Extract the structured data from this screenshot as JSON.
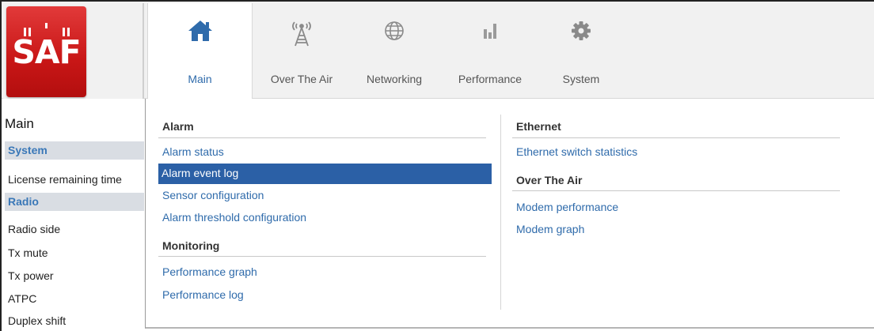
{
  "logo": {
    "text": "SAF"
  },
  "tabs": [
    {
      "label": "Main",
      "icon": "home-icon",
      "active": true
    },
    {
      "label": "Over The Air",
      "icon": "antenna-tower-icon",
      "active": false
    },
    {
      "label": "Networking",
      "icon": "globe-icon",
      "active": false
    },
    {
      "label": "Performance",
      "icon": "bar-chart-icon",
      "active": false
    },
    {
      "label": "System",
      "icon": "gear-icon",
      "active": false
    }
  ],
  "sidebar": {
    "title": "Main",
    "sections": [
      {
        "label": "System",
        "items": [
          "License remaining time"
        ]
      },
      {
        "label": "Radio",
        "items": [
          "Radio side",
          "Tx mute",
          "Tx power",
          "ATPC",
          "Duplex shift"
        ]
      }
    ]
  },
  "menu": {
    "left": {
      "groups": [
        {
          "heading": "Alarm",
          "links": [
            "Alarm status",
            "Alarm event log",
            "Sensor configuration",
            "Alarm threshold configuration"
          ]
        },
        {
          "heading": "Monitoring",
          "links": [
            "Performance graph",
            "Performance log"
          ]
        }
      ]
    },
    "right": {
      "groups": [
        {
          "heading": "Ethernet",
          "links": [
            "Ethernet switch statistics"
          ]
        },
        {
          "heading": "Over The Air",
          "links": [
            "Modem performance",
            "Modem graph"
          ]
        }
      ]
    },
    "selected_link": "Alarm event log"
  },
  "colors": {
    "accent": "#2f6bab",
    "selected_bg": "#2b60a6",
    "logo_red": "#c81616",
    "section_bg": "#d9dde3"
  }
}
